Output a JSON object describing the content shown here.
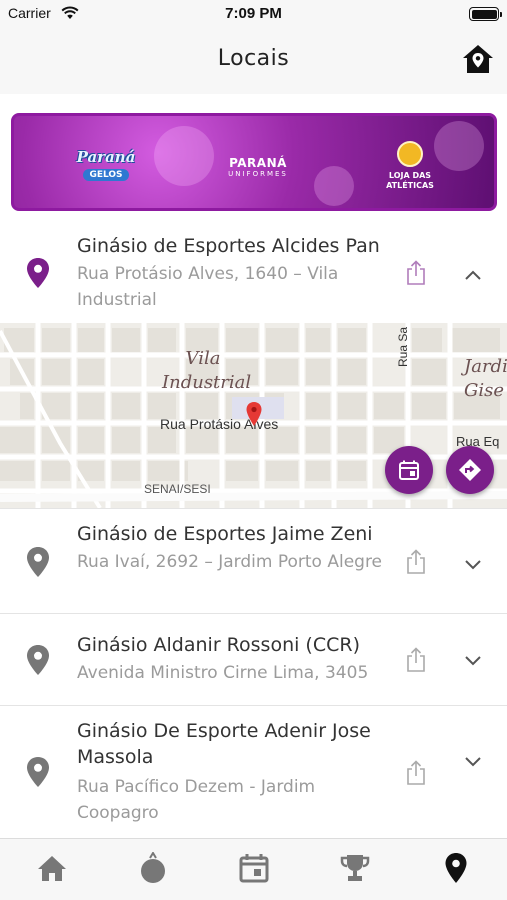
{
  "status_bar": {
    "carrier": "Carrier",
    "time": "7:09 PM"
  },
  "nav": {
    "title": "Locais",
    "home_icon": "home-pin-icon"
  },
  "banner": {
    "logos": [
      {
        "name": "Paraná",
        "sub": "GELOS"
      },
      {
        "name": "PARANÁ",
        "sub": "UNIFORMES"
      },
      {
        "name": "LOJA DAS ATLÉTICAS"
      }
    ]
  },
  "locations": [
    {
      "name": "Ginásio de Esportes Alcides Pan",
      "address": "Rua Protásio Alves, 1640 – Vila Industrial",
      "expanded": true
    },
    {
      "name": "Ginásio de Esportes Jaime Zeni",
      "address": "Rua Ivaí, 2692 – Jardim Porto Alegre",
      "expanded": false
    },
    {
      "name": "Ginásio Aldanir Rossoni (CCR)",
      "address": "Avenida Ministro Cirne Lima, 3405",
      "expanded": false
    },
    {
      "name": "Ginásio De Esporte Adenir Jose Massola",
      "address": "Rua Pacífico Dezem - Jardim Coopagro",
      "expanded": false
    }
  ],
  "map": {
    "district": "Vila Industrial",
    "district_right": "Jardim Gise",
    "street": "Rua Protásio Alves",
    "street_vertical": "Rua Sa",
    "street_right": "Rua Eq",
    "poi": "SENAI/SESI"
  },
  "tab_bar": {
    "tabs": [
      "home-icon",
      "ball-icon",
      "calendar-icon",
      "trophy-icon",
      "location-pin-icon"
    ],
    "active": "location-pin-icon"
  },
  "colors": {
    "accent": "#7b1f8a",
    "pin_inactive": "#777777",
    "map_pin": "#e53935"
  }
}
